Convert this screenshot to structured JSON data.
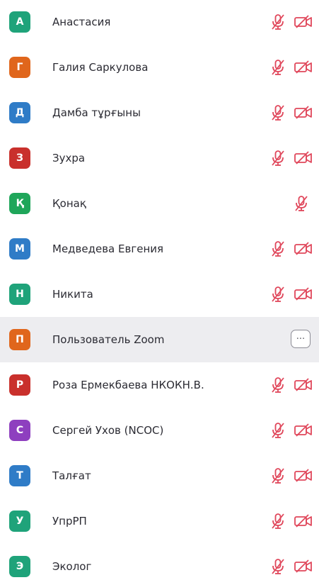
{
  "colors": {
    "icon_red": "#e0475b",
    "text": "#2b2b33",
    "hover_background": "#ededf0"
  },
  "participants": [
    {
      "initial": "А",
      "name": "Анастасия",
      "color": "#1fa37a",
      "mic": "mic-muted-icon",
      "video": "video-off-icon"
    },
    {
      "initial": "Г",
      "name": "Галия Саркулова",
      "color": "#e0661c",
      "mic": "mic-muted-icon",
      "video": "video-off-icon"
    },
    {
      "initial": "Д",
      "name": "Дамба тұрғыны",
      "color": "#2f7cc7",
      "mic": "mic-muted-icon",
      "video": "video-off-icon"
    },
    {
      "initial": "З",
      "name": "Зухра",
      "color": "#c9302c",
      "mic": "mic-muted-icon",
      "video": "video-off-icon"
    },
    {
      "initial": "Қ",
      "name": "Қонақ",
      "color": "#1fa65a",
      "mic": "mic-muted-icon",
      "video": null
    },
    {
      "initial": "М",
      "name": "Медведева Евгения",
      "color": "#2f7cc7",
      "mic": "mic-muted-icon",
      "video": "video-off-icon"
    },
    {
      "initial": "Н",
      "name": "Никита",
      "color": "#1fa37a",
      "mic": "mic-muted-icon",
      "video": "video-off-icon"
    },
    {
      "initial": "П",
      "name": "Пользователь Zoom",
      "color": "#e0661c",
      "mic": null,
      "video": null,
      "hover": true,
      "more": "···"
    },
    {
      "initial": "Р",
      "name": "Роза Ермекбаева НКОКН.В.",
      "color": "#c9302c",
      "mic": "mic-muted-icon",
      "video": "video-off-icon"
    },
    {
      "initial": "С",
      "name": "Сергей Ухов (NCOC)",
      "color": "#8e3fbf",
      "mic": "mic-muted-icon",
      "video": "video-off-icon"
    },
    {
      "initial": "Т",
      "name": "Талғат",
      "color": "#2f7cc7",
      "mic": "mic-muted-icon",
      "video": "video-off-icon"
    },
    {
      "initial": "У",
      "name": "УпрРП",
      "color": "#1fa37a",
      "mic": "mic-muted-icon",
      "video": "video-off-icon"
    },
    {
      "initial": "Э",
      "name": "Эколог",
      "color": "#1fa37a",
      "mic": "mic-muted-icon",
      "video": "video-off-icon"
    }
  ]
}
